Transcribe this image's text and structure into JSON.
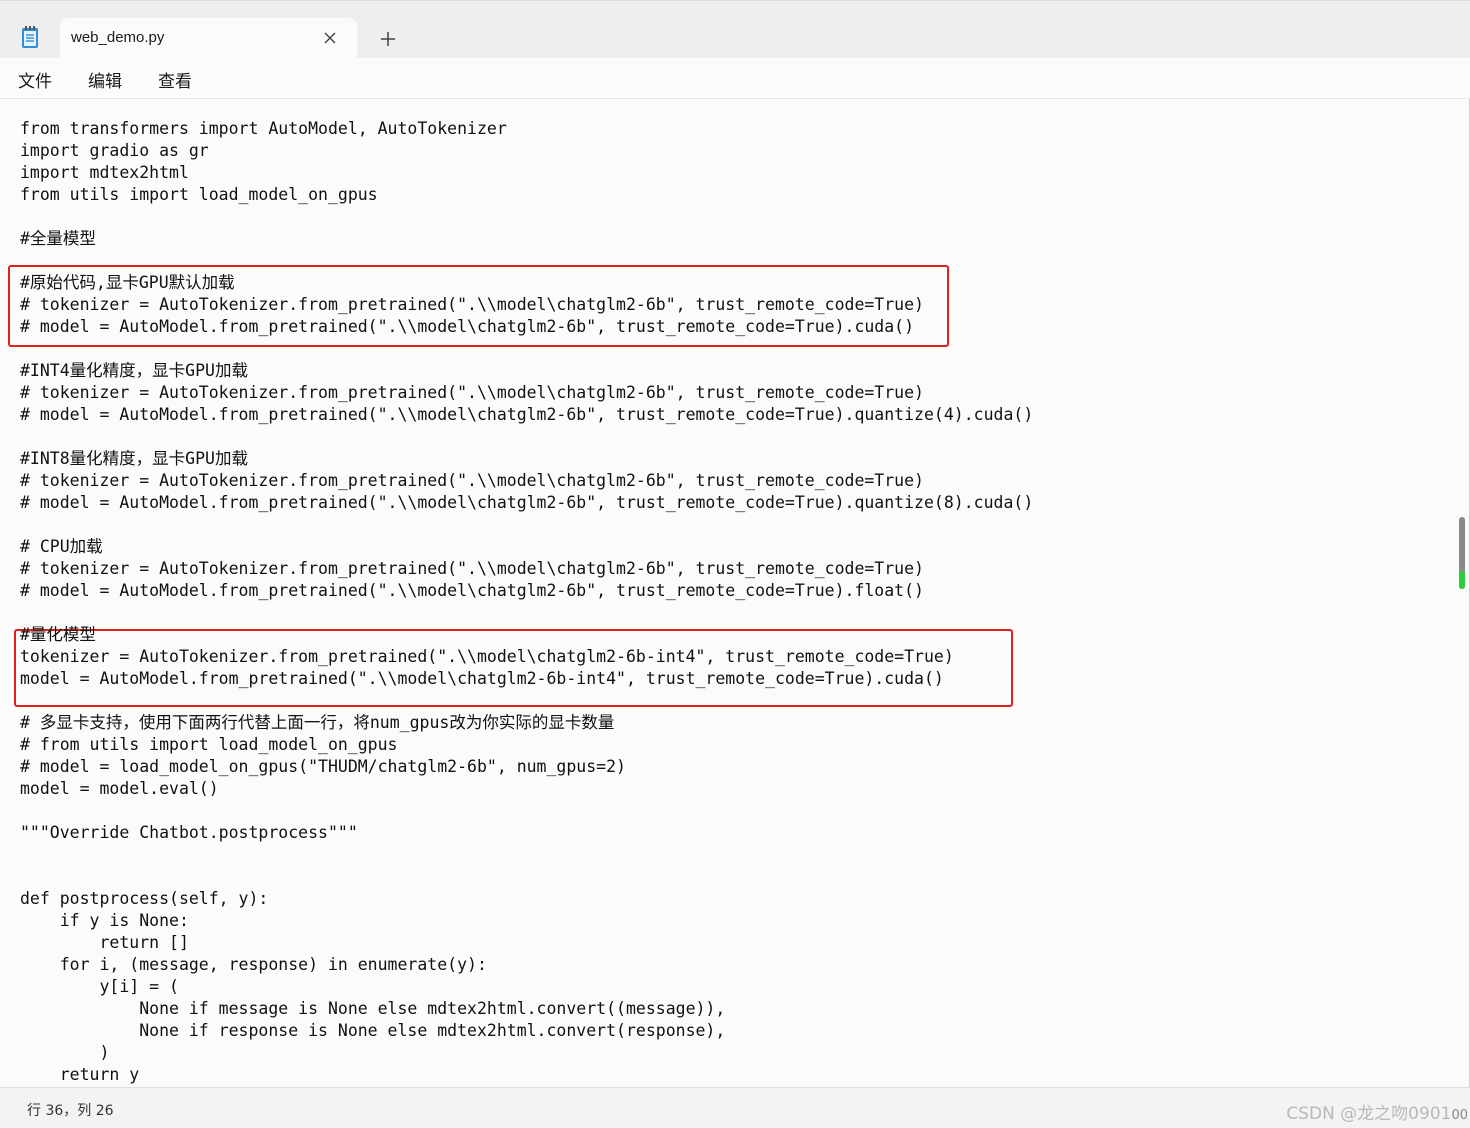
{
  "tab": {
    "title": "web_demo.py"
  },
  "menu": {
    "file": "文件",
    "edit": "编辑",
    "view": "查看"
  },
  "code": {
    "lines": [
      "from transformers import AutoModel, AutoTokenizer",
      "import gradio as gr",
      "import mdtex2html",
      "from utils import load_model_on_gpus",
      "",
      "#全量模型",
      "",
      "#原始代码,显卡GPU默认加载",
      "# tokenizer = AutoTokenizer.from_pretrained(\".\\\\model\\chatglm2-6b\", trust_remote_code=True)",
      "# model = AutoModel.from_pretrained(\".\\\\model\\chatglm2-6b\", trust_remote_code=True).cuda()",
      "",
      "#INT4量化精度，显卡GPU加载",
      "# tokenizer = AutoTokenizer.from_pretrained(\".\\\\model\\chatglm2-6b\", trust_remote_code=True)",
      "# model = AutoModel.from_pretrained(\".\\\\model\\chatglm2-6b\", trust_remote_code=True).quantize(4).cuda()",
      "",
      "#INT8量化精度，显卡GPU加载",
      "# tokenizer = AutoTokenizer.from_pretrained(\".\\\\model\\chatglm2-6b\", trust_remote_code=True)",
      "# model = AutoModel.from_pretrained(\".\\\\model\\chatglm2-6b\", trust_remote_code=True).quantize(8).cuda()",
      "",
      "# CPU加载",
      "# tokenizer = AutoTokenizer.from_pretrained(\".\\\\model\\chatglm2-6b\", trust_remote_code=True)",
      "# model = AutoModel.from_pretrained(\".\\\\model\\chatglm2-6b\", trust_remote_code=True).float()",
      "",
      "#量化模型",
      "tokenizer = AutoTokenizer.from_pretrained(\".\\\\model\\chatglm2-6b-int4\", trust_remote_code=True)",
      "model = AutoModel.from_pretrained(\".\\\\model\\chatglm2-6b-int4\", trust_remote_code=True).cuda()",
      "",
      "# 多显卡支持，使用下面两行代替上面一行，将num_gpus改为你实际的显卡数量",
      "# from utils import load_model_on_gpus",
      "# model = load_model_on_gpus(\"THUDM/chatglm2-6b\", num_gpus=2)",
      "model = model.eval()",
      "",
      "\"\"\"Override Chatbot.postprocess\"\"\"",
      "",
      "",
      "def postprocess(self, y):",
      "    if y is None:",
      "        return []",
      "    for i, (message, response) in enumerate(y):",
      "        y[i] = (",
      "            None if message is None else mdtex2html.convert((message)),",
      "            None if response is None else mdtex2html.convert(response),",
      "        )",
      "    return y"
    ]
  },
  "status": {
    "position": "行 36，列 26"
  },
  "watermark": {
    "text": "CSDN @龙之吻0901",
    "suffix": "00"
  },
  "colors": {
    "highlight_border": "#e0201a",
    "scroll_accent": "#2ecc40"
  }
}
